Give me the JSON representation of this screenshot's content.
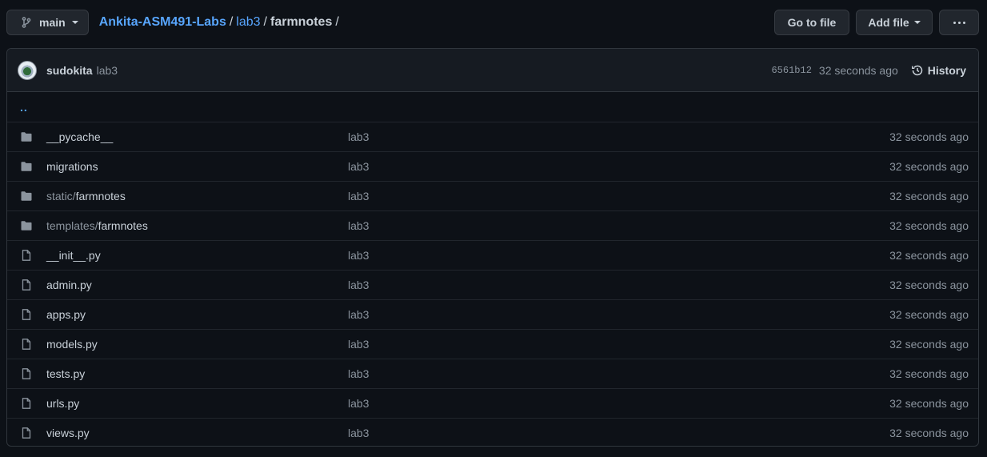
{
  "branch": {
    "label": "main"
  },
  "breadcrumb": {
    "repo": "Ankita-ASM491-Labs",
    "sep": "/",
    "folder1": "lab3",
    "folder2": "farmnotes",
    "trailing": "/"
  },
  "actions": {
    "goto": "Go to file",
    "add": "Add file"
  },
  "commit": {
    "author": "sudokita",
    "message": "lab3",
    "sha": "6561b12",
    "time": "32 seconds ago",
    "history": "History"
  },
  "parent_link": "..",
  "files": [
    {
      "type": "dir",
      "prefix": "",
      "name": "__pycache__",
      "message": "lab3",
      "age": "32 seconds ago"
    },
    {
      "type": "dir",
      "prefix": "",
      "name": "migrations",
      "message": "lab3",
      "age": "32 seconds ago"
    },
    {
      "type": "dir",
      "prefix": "static/",
      "name": "farmnotes",
      "message": "lab3",
      "age": "32 seconds ago"
    },
    {
      "type": "dir",
      "prefix": "templates/",
      "name": "farmnotes",
      "message": "lab3",
      "age": "32 seconds ago"
    },
    {
      "type": "file",
      "prefix": "",
      "name": "__init__.py",
      "message": "lab3",
      "age": "32 seconds ago"
    },
    {
      "type": "file",
      "prefix": "",
      "name": "admin.py",
      "message": "lab3",
      "age": "32 seconds ago"
    },
    {
      "type": "file",
      "prefix": "",
      "name": "apps.py",
      "message": "lab3",
      "age": "32 seconds ago"
    },
    {
      "type": "file",
      "prefix": "",
      "name": "models.py",
      "message": "lab3",
      "age": "32 seconds ago"
    },
    {
      "type": "file",
      "prefix": "",
      "name": "tests.py",
      "message": "lab3",
      "age": "32 seconds ago"
    },
    {
      "type": "file",
      "prefix": "",
      "name": "urls.py",
      "message": "lab3",
      "age": "32 seconds ago"
    },
    {
      "type": "file",
      "prefix": "",
      "name": "views.py",
      "message": "lab3",
      "age": "32 seconds ago"
    }
  ],
  "colors": {
    "background": "#0d1117",
    "link": "#58a6ff",
    "muted": "#8b949e",
    "border": "#30363d"
  },
  "icons": {
    "branch": "git-branch-icon",
    "history": "history-clock-icon",
    "dir": "folder-icon",
    "file": "file-icon",
    "more": "kebab-horizontal-icon"
  }
}
